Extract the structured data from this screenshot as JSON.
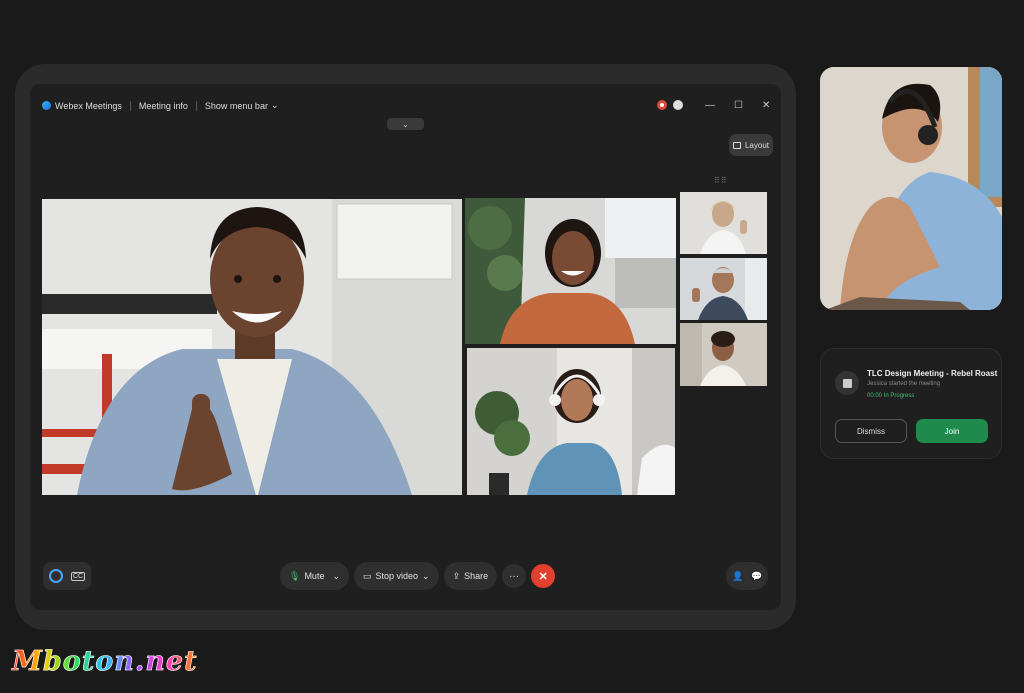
{
  "app": {
    "name": "Webex Meetings",
    "meeting_info": "Meeting info",
    "show_menu_bar": "Show menu bar",
    "collapse_icon": "chevron-down-icon"
  },
  "window_controls": {
    "minimize": "—",
    "maximize": "☐",
    "close": "✕"
  },
  "layout_button": {
    "label": "Layout"
  },
  "grid_handle": "⠿⠿",
  "toolbar": {
    "mute": "Mute",
    "stop_video": "Stop video",
    "share": "Share",
    "more": "···",
    "end": "✕"
  },
  "notification": {
    "title": "TLC Design Meeting - Rebel Roast",
    "subtitle": "Jessica started the meeting",
    "status": "00:00 In Progress",
    "dismiss": "Dismiss",
    "join": "Join"
  },
  "watermark": "Mboton.net",
  "colors": {
    "accent_green": "#1f8a4c",
    "end_call_red": "#e2402f",
    "record_red": "#e0463a",
    "webex_blue": "#1d6fe0"
  }
}
